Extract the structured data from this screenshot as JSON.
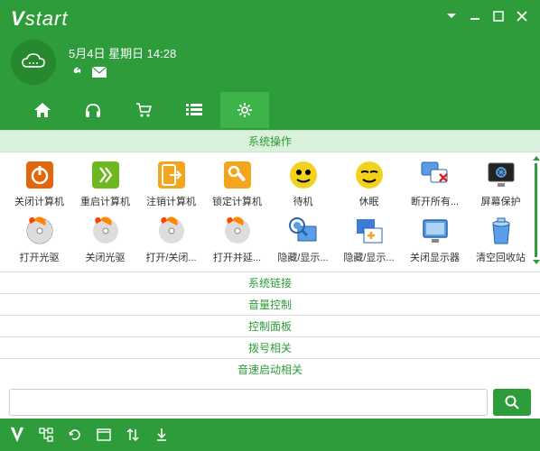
{
  "logo": "Vstart",
  "datetime": "5月4日 星期日 14:28",
  "tabs": [
    {
      "name": "home-icon"
    },
    {
      "name": "headphones-icon"
    },
    {
      "name": "cart-icon"
    },
    {
      "name": "list-icon"
    },
    {
      "name": "gear-icon",
      "active": true
    }
  ],
  "sections": [
    {
      "title": "系统操作",
      "items": [
        {
          "label": "关闭计算机",
          "icon": "power-off"
        },
        {
          "label": "重启计算机",
          "icon": "restart"
        },
        {
          "label": "注销计算机",
          "icon": "logout"
        },
        {
          "label": "锁定计算机",
          "icon": "lock"
        },
        {
          "label": "待机",
          "icon": "standby"
        },
        {
          "label": "休眠",
          "icon": "hibernate"
        },
        {
          "label": "断开所有...",
          "icon": "disconnect"
        },
        {
          "label": "屏幕保护",
          "icon": "screensaver"
        },
        {
          "label": "打开光驱",
          "icon": "cd-open"
        },
        {
          "label": "关闭光驱",
          "icon": "cd-close"
        },
        {
          "label": "打开/关闭...",
          "icon": "cd-toggle"
        },
        {
          "label": "打开并延...",
          "icon": "cd-delay"
        },
        {
          "label": "隐藏/显示...",
          "icon": "hide-show-1"
        },
        {
          "label": "隐藏/显示...",
          "icon": "hide-show-2"
        },
        {
          "label": "关闭显示器",
          "icon": "monitor-off"
        },
        {
          "label": "清空回收站",
          "icon": "recycle"
        }
      ]
    }
  ],
  "links": [
    {
      "title": "系统链接"
    },
    {
      "title": "音量控制"
    },
    {
      "title": "控制面板"
    },
    {
      "title": "拨号相关"
    },
    {
      "title": "音速启动相关"
    }
  ],
  "search": {
    "placeholder": ""
  }
}
